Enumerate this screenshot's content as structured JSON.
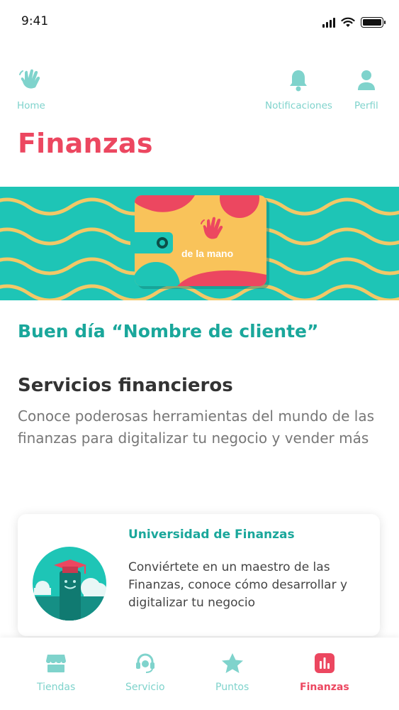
{
  "status_bar": {
    "time": "9:41"
  },
  "top_nav": {
    "home_label": "Home",
    "notifications_label": "Notificaciones",
    "profile_label": "Perfil"
  },
  "page_title": "Finanzas",
  "banner": {
    "wallet_text": "de la mano"
  },
  "greeting": "Buen día “Nombre de cliente”",
  "section": {
    "title": "Servicios financieros",
    "description": "Conoce poderosas herramientas del mundo de las finanzas para digitalizar tu negocio y vender más"
  },
  "card": {
    "title": "Universidad de Finanzas",
    "description": "Conviértete en un maestro de las Finanzas, conoce cómo desarrollar y digitalizar tu negocio"
  },
  "bottom_nav": {
    "tabs": [
      {
        "label": "Tiendas",
        "icon": "store-icon"
      },
      {
        "label": "Servicio",
        "icon": "headset-icon"
      },
      {
        "label": "Puntos",
        "icon": "star-icon"
      },
      {
        "label": "Finanzas",
        "icon": "chart-icon"
      }
    ],
    "active_tab": "Finanzas"
  },
  "colors": {
    "accent_red": "#ec4760",
    "teal": "#1ec5b6",
    "teal_dark": "#1aa79b",
    "icon_teal": "#7fd3cc",
    "wallet_yellow": "#f9c35a"
  }
}
